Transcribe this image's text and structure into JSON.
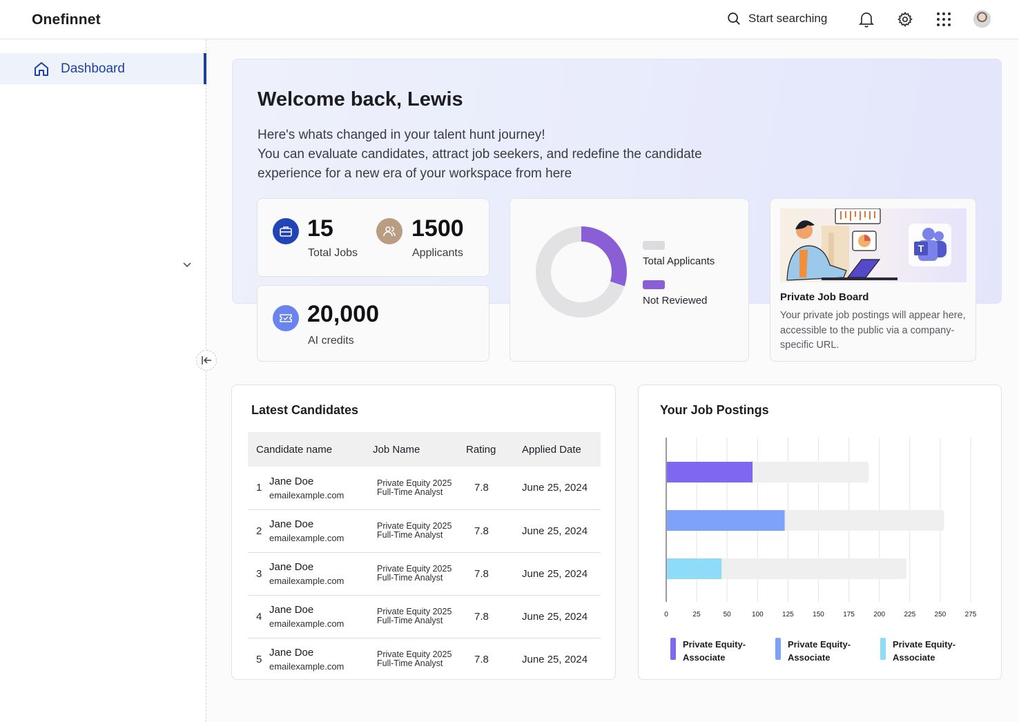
{
  "app": {
    "title": "Onefinnet"
  },
  "header": {
    "search_label": "Start searching"
  },
  "sidebar": {
    "items": [
      {
        "label": "Dashboard",
        "icon": "home-icon"
      }
    ]
  },
  "hero": {
    "title": "Welcome back, Lewis",
    "line1": "Here's whats changed in your talent hunt journey!",
    "line2": "You can evaluate candidates, attract job seekers, and redefine the candidate experience for a new era of your workspace from here"
  },
  "stats": {
    "total_jobs": {
      "value": "15",
      "label": "Total Jobs"
    },
    "applicants": {
      "value": "1500",
      "label": "Applicants"
    },
    "ai_credits": {
      "value": "20,000",
      "label": "AI credits"
    }
  },
  "donut": {
    "legend": [
      {
        "label": "Total Applicants",
        "color": "#dcdcdf"
      },
      {
        "label": "Not Reviewed",
        "color": "#8a5fd6"
      }
    ],
    "not_reviewed_fraction": 0.3
  },
  "job_board": {
    "title": "Private Job Board",
    "description": "Your private job postings will appear here, accessible to the public via a company-specific URL."
  },
  "latest_candidates": {
    "title": "Latest Candidates",
    "columns": [
      "Candidate name",
      "Job Name",
      "Rating",
      "Applied Date"
    ],
    "rows": [
      {
        "index": "1",
        "name": "Jane Doe",
        "email": "emailexample.com",
        "job_line1": "Private Equity 2025",
        "job_line2": "Full-Time Analyst",
        "rating": "7.8",
        "date": "June 25, 2024"
      },
      {
        "index": "2",
        "name": "Jane Doe",
        "email": "emailexample.com",
        "job_line1": "Private Equity 2025",
        "job_line2": "Full-Time Analyst",
        "rating": "7.8",
        "date": "June 25, 2024"
      },
      {
        "index": "3",
        "name": "Jane Doe",
        "email": "emailexample.com",
        "job_line1": "Private Equity 2025",
        "job_line2": "Full-Time Analyst",
        "rating": "7.8",
        "date": "June 25, 2024"
      },
      {
        "index": "4",
        "name": "Jane Doe",
        "email": "emailexample.com",
        "job_line1": "Private Equity 2025",
        "job_line2": "Full-Time Analyst",
        "rating": "7.8",
        "date": "June 25, 2024"
      },
      {
        "index": "5",
        "name": "Jane Doe",
        "email": "emailexample.com",
        "job_line1": "Private Equity 2025",
        "job_line2": "Full-Time Analyst",
        "rating": "7.8",
        "date": "June 25, 2024"
      }
    ]
  },
  "job_postings": {
    "title": "Your Job Postings"
  },
  "chart_data": {
    "type": "bar",
    "orientation": "horizontal",
    "xlim": [
      0,
      275
    ],
    "xticks": [
      "0",
      "25",
      "50",
      "100",
      "125",
      "150",
      "175",
      "200",
      "225",
      "250",
      "275"
    ],
    "grid": true,
    "legend_position": "bottom",
    "series": [
      {
        "name": "Private Equity- Associate",
        "value": 78,
        "total": 183,
        "color": "#7f67f2"
      },
      {
        "name": "Private Equity- Associate",
        "value": 107,
        "total": 251,
        "color": "#7da2f7"
      },
      {
        "name": "Private Equity- Associate",
        "value": 50,
        "total": 217,
        "color": "#8edcf8"
      }
    ],
    "track_color": "#efefef"
  }
}
